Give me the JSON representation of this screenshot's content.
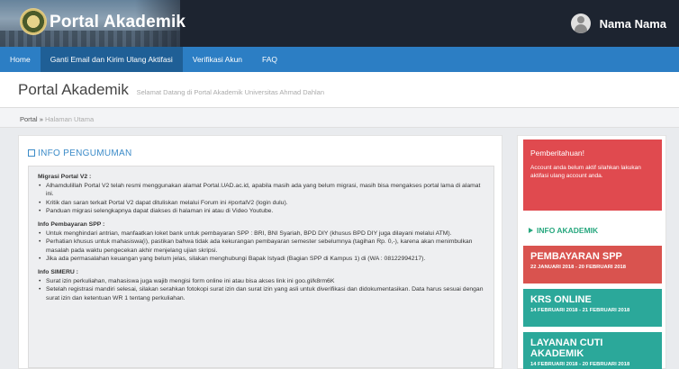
{
  "header": {
    "brand": "Portal Akademik",
    "user_name": "Nama Nama"
  },
  "nav": {
    "items": [
      {
        "label": "Home"
      },
      {
        "label": "Ganti Email dan Kirim Ulang Aktifasi"
      },
      {
        "label": "Verifikasi Akun"
      },
      {
        "label": "FAQ"
      }
    ],
    "active_index": 1
  },
  "page": {
    "title": "Portal Akademik",
    "subtitle": "Selamat Datang di Portal Akademik Universitas Ahmad Dahlan"
  },
  "breadcrumb": {
    "root": "Portal",
    "separator": "»",
    "current": "Halaman Utama"
  },
  "announcement": {
    "heading": "INFO PENGUMUMAN",
    "sections": [
      {
        "title": "Migrasi Portal V2 :",
        "items": [
          "Alhamdulillah Portal V2 telah resmi menggunakan alamat Portal.UAD.ac.id, apabila masih ada yang belum migrasi, masih bisa mengakses portal lama di alamat ini.",
          "Kritik dan saran terkait Portal V2 dapat dituliskan melalui Forum ini #portalV2 (login dulu).",
          "Panduan migrasi selengkapnya dapat diakses di halaman ini atau di Video Youtube."
        ]
      },
      {
        "title": "Info Pembayaran SPP :",
        "items": [
          "Untuk menghindari antrian, manfaatkan loket bank untuk pembayaran SPP : BRI, BNI Syariah, BPD DIY (khusus BPD DIY juga dilayani melalui ATM).",
          "Perhatian khusus untuk mahasiswa(i), pastikan bahwa tidak ada kekurangan pembayaran semester sebelumnya (tagihan Rp. 0,-), karena akan menimbulkan masalah pada waktu pengecekan akhir menjelang ujian skripsi.",
          "Jika ada permasalahan keuangan yang belum jelas, silakan menghubungi Bapak Istyadi (Bagian SPP di Kampus 1) di (WA : 08122994217)."
        ]
      },
      {
        "title": "Info SIMERU :",
        "items": [
          "Surat izin perkuliahan, mahasiswa juga wajib mengisi form online ini atau bisa akses link ini goo.gl/k8rm6K",
          "Setelah registrasi mandiri selesai, silakan serahkan fotokopi surat izin dan surat izin yang asli untuk diverifikasi dan didokumentasikan. Data harus sesuai dengan surat izin dan ketentuan WR 1 tentang perkuliahan."
        ]
      }
    ]
  },
  "sidebar": {
    "alert": {
      "title": "Pemberitahuan!",
      "message": "Account anda belum aktif silahkan lakukan aktifasi ulang account anda."
    },
    "info_heading": "INFO AKADEMIK",
    "cards": [
      {
        "title": "PEMBAYARAN SPP",
        "dates": "22 JANUARI 2018 - 20 FEBRUARI 2018",
        "color": "#d9534f"
      },
      {
        "title": "KRS ONLINE",
        "dates": "14 FEBRUARI 2018 - 21 FEBRUARI 2018",
        "color": "#2ba89a"
      },
      {
        "title": "LAYANAN CUTI AKADEMIK",
        "dates": "14 FEBRUARI 2018 - 20 FEBRUARI 2018",
        "color": "#2ba89a"
      }
    ]
  }
}
